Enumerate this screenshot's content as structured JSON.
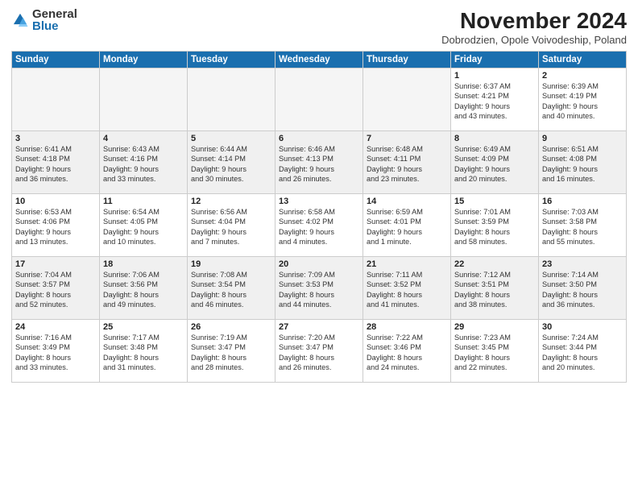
{
  "logo": {
    "general": "General",
    "blue": "Blue"
  },
  "title": "November 2024",
  "subtitle": "Dobrodzien, Opole Voivodeship, Poland",
  "headers": [
    "Sunday",
    "Monday",
    "Tuesday",
    "Wednesday",
    "Thursday",
    "Friday",
    "Saturday"
  ],
  "weeks": [
    [
      {
        "day": "",
        "info": ""
      },
      {
        "day": "",
        "info": ""
      },
      {
        "day": "",
        "info": ""
      },
      {
        "day": "",
        "info": ""
      },
      {
        "day": "",
        "info": ""
      },
      {
        "day": "1",
        "info": "Sunrise: 6:37 AM\nSunset: 4:21 PM\nDaylight: 9 hours\nand 43 minutes."
      },
      {
        "day": "2",
        "info": "Sunrise: 6:39 AM\nSunset: 4:19 PM\nDaylight: 9 hours\nand 40 minutes."
      }
    ],
    [
      {
        "day": "3",
        "info": "Sunrise: 6:41 AM\nSunset: 4:18 PM\nDaylight: 9 hours\nand 36 minutes."
      },
      {
        "day": "4",
        "info": "Sunrise: 6:43 AM\nSunset: 4:16 PM\nDaylight: 9 hours\nand 33 minutes."
      },
      {
        "day": "5",
        "info": "Sunrise: 6:44 AM\nSunset: 4:14 PM\nDaylight: 9 hours\nand 30 minutes."
      },
      {
        "day": "6",
        "info": "Sunrise: 6:46 AM\nSunset: 4:13 PM\nDaylight: 9 hours\nand 26 minutes."
      },
      {
        "day": "7",
        "info": "Sunrise: 6:48 AM\nSunset: 4:11 PM\nDaylight: 9 hours\nand 23 minutes."
      },
      {
        "day": "8",
        "info": "Sunrise: 6:49 AM\nSunset: 4:09 PM\nDaylight: 9 hours\nand 20 minutes."
      },
      {
        "day": "9",
        "info": "Sunrise: 6:51 AM\nSunset: 4:08 PM\nDaylight: 9 hours\nand 16 minutes."
      }
    ],
    [
      {
        "day": "10",
        "info": "Sunrise: 6:53 AM\nSunset: 4:06 PM\nDaylight: 9 hours\nand 13 minutes."
      },
      {
        "day": "11",
        "info": "Sunrise: 6:54 AM\nSunset: 4:05 PM\nDaylight: 9 hours\nand 10 minutes."
      },
      {
        "day": "12",
        "info": "Sunrise: 6:56 AM\nSunset: 4:04 PM\nDaylight: 9 hours\nand 7 minutes."
      },
      {
        "day": "13",
        "info": "Sunrise: 6:58 AM\nSunset: 4:02 PM\nDaylight: 9 hours\nand 4 minutes."
      },
      {
        "day": "14",
        "info": "Sunrise: 6:59 AM\nSunset: 4:01 PM\nDaylight: 9 hours\nand 1 minute."
      },
      {
        "day": "15",
        "info": "Sunrise: 7:01 AM\nSunset: 3:59 PM\nDaylight: 8 hours\nand 58 minutes."
      },
      {
        "day": "16",
        "info": "Sunrise: 7:03 AM\nSunset: 3:58 PM\nDaylight: 8 hours\nand 55 minutes."
      }
    ],
    [
      {
        "day": "17",
        "info": "Sunrise: 7:04 AM\nSunset: 3:57 PM\nDaylight: 8 hours\nand 52 minutes."
      },
      {
        "day": "18",
        "info": "Sunrise: 7:06 AM\nSunset: 3:56 PM\nDaylight: 8 hours\nand 49 minutes."
      },
      {
        "day": "19",
        "info": "Sunrise: 7:08 AM\nSunset: 3:54 PM\nDaylight: 8 hours\nand 46 minutes."
      },
      {
        "day": "20",
        "info": "Sunrise: 7:09 AM\nSunset: 3:53 PM\nDaylight: 8 hours\nand 44 minutes."
      },
      {
        "day": "21",
        "info": "Sunrise: 7:11 AM\nSunset: 3:52 PM\nDaylight: 8 hours\nand 41 minutes."
      },
      {
        "day": "22",
        "info": "Sunrise: 7:12 AM\nSunset: 3:51 PM\nDaylight: 8 hours\nand 38 minutes."
      },
      {
        "day": "23",
        "info": "Sunrise: 7:14 AM\nSunset: 3:50 PM\nDaylight: 8 hours\nand 36 minutes."
      }
    ],
    [
      {
        "day": "24",
        "info": "Sunrise: 7:16 AM\nSunset: 3:49 PM\nDaylight: 8 hours\nand 33 minutes."
      },
      {
        "day": "25",
        "info": "Sunrise: 7:17 AM\nSunset: 3:48 PM\nDaylight: 8 hours\nand 31 minutes."
      },
      {
        "day": "26",
        "info": "Sunrise: 7:19 AM\nSunset: 3:47 PM\nDaylight: 8 hours\nand 28 minutes."
      },
      {
        "day": "27",
        "info": "Sunrise: 7:20 AM\nSunset: 3:47 PM\nDaylight: 8 hours\nand 26 minutes."
      },
      {
        "day": "28",
        "info": "Sunrise: 7:22 AM\nSunset: 3:46 PM\nDaylight: 8 hours\nand 24 minutes."
      },
      {
        "day": "29",
        "info": "Sunrise: 7:23 AM\nSunset: 3:45 PM\nDaylight: 8 hours\nand 22 minutes."
      },
      {
        "day": "30",
        "info": "Sunrise: 7:24 AM\nSunset: 3:44 PM\nDaylight: 8 hours\nand 20 minutes."
      }
    ]
  ]
}
